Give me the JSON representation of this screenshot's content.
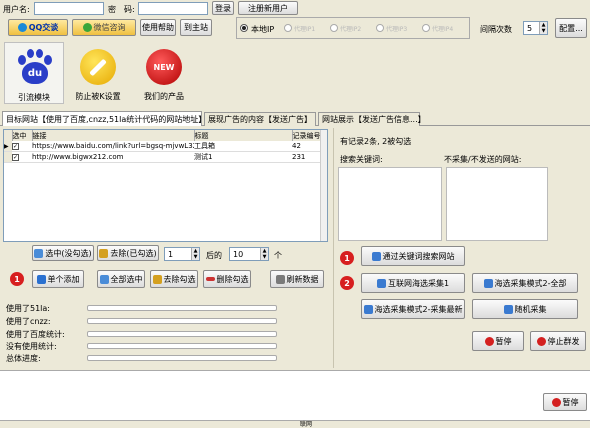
{
  "login": {
    "username_label": "用户名:",
    "password_label": "密　码:",
    "login_button": "登录",
    "register_button": "注册新用户"
  },
  "toolbar": {
    "qq_button": "QQ交谈",
    "wechat_button": "微信咨询",
    "help_button": "使用帮助",
    "home_button": "到主站"
  },
  "options": {
    "local_ip": "本地IP",
    "greyed": [
      "代理IP1",
      "代理IP2",
      "代理IP3",
      "代理IP4"
    ],
    "interval_label": "间隔次数",
    "interval_value": "5",
    "config_button": "配置..."
  },
  "modules": [
    {
      "label": "引流模块",
      "icon": "baidu-icon"
    },
    {
      "label": "防止被K设置",
      "icon": "wrench-icon"
    },
    {
      "label": "我们的产品",
      "icon": "new-icon"
    }
  ],
  "tabs": [
    "目标网站【使用了百度,cnzz,51la统计代码的网站地址】",
    "展现广告的内容【发送广告】",
    "网站展示【发送广告信息...】"
  ],
  "table": {
    "headers": [
      "选中",
      "链接",
      "标题",
      "记录编号"
    ],
    "rows": [
      {
        "link": "https://www.baidu.com/link?url=bgsq-mjvwL32q...",
        "title": "工具箱",
        "id": "42"
      },
      {
        "link": "http://www.bigwx212.com",
        "title": "测试1",
        "id": "231"
      }
    ]
  },
  "selection": {
    "select_unselected": "选中(没勾选)",
    "remove_checked": "去除(已勾选)",
    "from_value": "1",
    "after_label": "后的",
    "to_value": "10",
    "unit": "个"
  },
  "actions": {
    "add_single": "单个添加",
    "select_all": "全部选中",
    "remove_checked": "去除勾选",
    "delete_checked": "删除勾选",
    "refresh": "刷新数据"
  },
  "stats": {
    "labels": [
      "使用了51la:",
      "使用了cnzz:",
      "使用了百度统计:",
      "没有使用统计:",
      "总体进度:"
    ]
  },
  "right": {
    "summary": "有记录2条, 2被勾选",
    "keywords_label": "搜索关键词:",
    "noncollect_label": "不采集/不发送的网站:",
    "search_button": "通过关键词搜索网站",
    "collect1": "互联网海选采集1",
    "collect_all": "海选采集模式2-全部",
    "collect_newest": "海选采集模式2-采集最新",
    "random_collect": "随机采集",
    "pause": "暂停",
    "stop": "停止群发"
  },
  "badges": [
    "1",
    "1",
    "2"
  ],
  "bottom": {
    "pause": "暂停",
    "status_text": "联网"
  }
}
